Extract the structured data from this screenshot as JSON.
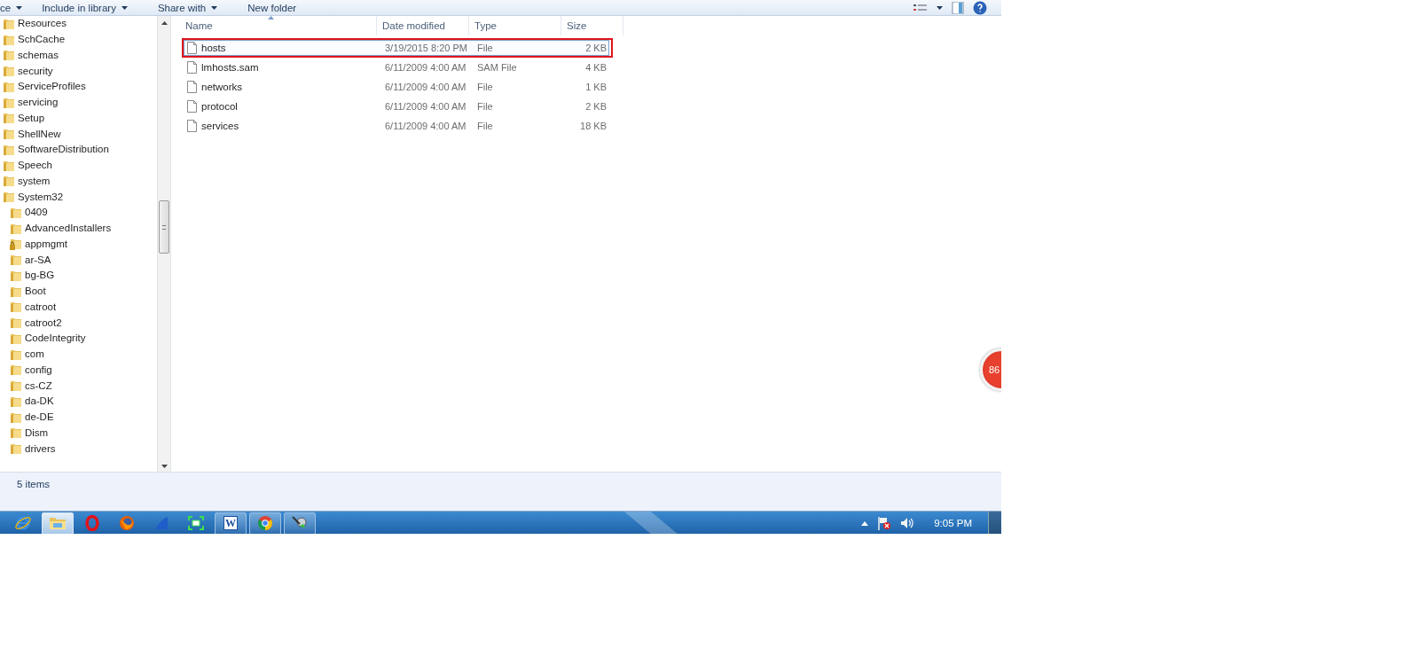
{
  "toolbar": {
    "items": [
      {
        "label": "ce",
        "dropdown": true
      },
      {
        "label": "Include in library",
        "dropdown": true
      },
      {
        "label": "Share with",
        "dropdown": true
      },
      {
        "label": "New folder",
        "dropdown": false
      }
    ]
  },
  "navigation_tree": {
    "items": [
      {
        "label": "Resources",
        "locked": false
      },
      {
        "label": "SchCache",
        "locked": false
      },
      {
        "label": "schemas",
        "locked": false
      },
      {
        "label": "security",
        "locked": false
      },
      {
        "label": "ServiceProfiles",
        "locked": false
      },
      {
        "label": "servicing",
        "locked": false
      },
      {
        "label": "Setup",
        "locked": false
      },
      {
        "label": "ShellNew",
        "locked": false
      },
      {
        "label": "SoftwareDistribution",
        "locked": false
      },
      {
        "label": "Speech",
        "locked": false
      },
      {
        "label": "system",
        "locked": false
      },
      {
        "label": "System32",
        "locked": false,
        "children": [
          {
            "label": "0409",
            "locked": false
          },
          {
            "label": "AdvancedInstallers",
            "locked": false
          },
          {
            "label": "appmgmt",
            "locked": true
          },
          {
            "label": "ar-SA",
            "locked": false
          },
          {
            "label": "bg-BG",
            "locked": false
          },
          {
            "label": "Boot",
            "locked": false
          },
          {
            "label": "catroot",
            "locked": false
          },
          {
            "label": "catroot2",
            "locked": false
          },
          {
            "label": "CodeIntegrity",
            "locked": false
          },
          {
            "label": "com",
            "locked": false
          },
          {
            "label": "config",
            "locked": false
          },
          {
            "label": "cs-CZ",
            "locked": false
          },
          {
            "label": "da-DK",
            "locked": false
          },
          {
            "label": "de-DE",
            "locked": false
          },
          {
            "label": "Dism",
            "locked": false
          },
          {
            "label": "drivers",
            "locked": false
          }
        ]
      }
    ]
  },
  "file_list": {
    "columns": [
      {
        "label": "Name",
        "sorted": true
      },
      {
        "label": "Date modified",
        "sorted": false
      },
      {
        "label": "Type",
        "sorted": false
      },
      {
        "label": "Size",
        "sorted": false
      }
    ],
    "rows": [
      {
        "name": "hosts",
        "date_modified": "3/19/2015 8:20 PM",
        "type": "File",
        "size": "2 KB",
        "selected": true,
        "outlined": true
      },
      {
        "name": "lmhosts.sam",
        "date_modified": "6/11/2009 4:00 AM",
        "type": "SAM File",
        "size": "4 KB",
        "selected": false,
        "outlined": false
      },
      {
        "name": "networks",
        "date_modified": "6/11/2009 4:00 AM",
        "type": "File",
        "size": "1 KB",
        "selected": false,
        "outlined": false
      },
      {
        "name": "protocol",
        "date_modified": "6/11/2009 4:00 AM",
        "type": "File",
        "size": "2 KB",
        "selected": false,
        "outlined": false
      },
      {
        "name": "services",
        "date_modified": "6/11/2009 4:00 AM",
        "type": "File",
        "size": "18 KB",
        "selected": false,
        "outlined": false
      }
    ]
  },
  "notification_badge": {
    "count": "86"
  },
  "status_bar": {
    "text": "5 items"
  },
  "taskbar": {
    "buttons": [
      {
        "kind": "ie",
        "running": false,
        "active": false
      },
      {
        "kind": "explorer",
        "running": true,
        "active": true
      },
      {
        "kind": "opera",
        "running": false,
        "active": false
      },
      {
        "kind": "firefox",
        "running": false,
        "active": false
      },
      {
        "kind": "fin",
        "running": false,
        "active": false
      },
      {
        "kind": "frame",
        "running": false,
        "active": false
      },
      {
        "kind": "word",
        "label": "W",
        "running": true,
        "active": false
      },
      {
        "kind": "chrome",
        "running": true,
        "active": false
      },
      {
        "kind": "satellite",
        "running": true,
        "active": false
      }
    ],
    "tray": {
      "clock": "9:05 PM"
    }
  }
}
